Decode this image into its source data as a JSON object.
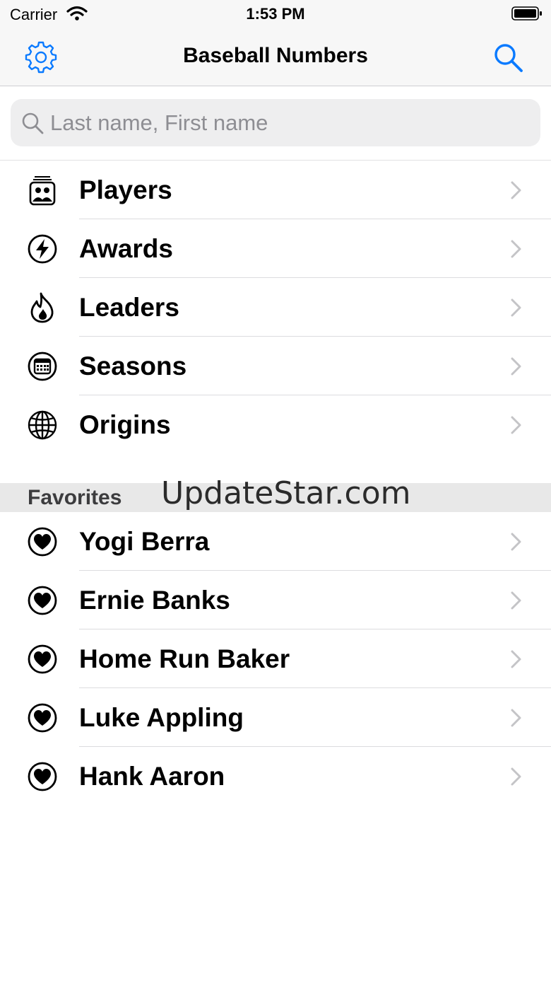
{
  "status": {
    "carrier": "Carrier",
    "time": "1:53 PM"
  },
  "nav": {
    "title": "Baseball Numbers",
    "settings_icon": "gear-icon",
    "search_icon": "search-icon"
  },
  "search": {
    "placeholder": "Last name, First name",
    "value": ""
  },
  "menu": [
    {
      "label": "Players",
      "icon": "players-icon"
    },
    {
      "label": "Awards",
      "icon": "bolt-icon"
    },
    {
      "label": "Leaders",
      "icon": "flame-icon"
    },
    {
      "label": "Seasons",
      "icon": "calendar-icon"
    },
    {
      "label": "Origins",
      "icon": "globe-icon"
    }
  ],
  "favorites": {
    "title": "Favorites",
    "items": [
      {
        "label": "Yogi Berra",
        "icon": "heart-icon"
      },
      {
        "label": "Ernie Banks",
        "icon": "heart-icon"
      },
      {
        "label": "Home Run Baker",
        "icon": "heart-icon"
      },
      {
        "label": "Luke Appling",
        "icon": "heart-icon"
      },
      {
        "label": "Hank Aaron",
        "icon": "heart-icon"
      }
    ]
  },
  "watermark": "UpdateStar.com",
  "colors": {
    "accent": "#0a7aff",
    "bar_bg": "#f7f7f7",
    "section_bg": "#e8e8e8",
    "placeholder": "#8e8e93",
    "chevron": "#c4c4c7"
  }
}
